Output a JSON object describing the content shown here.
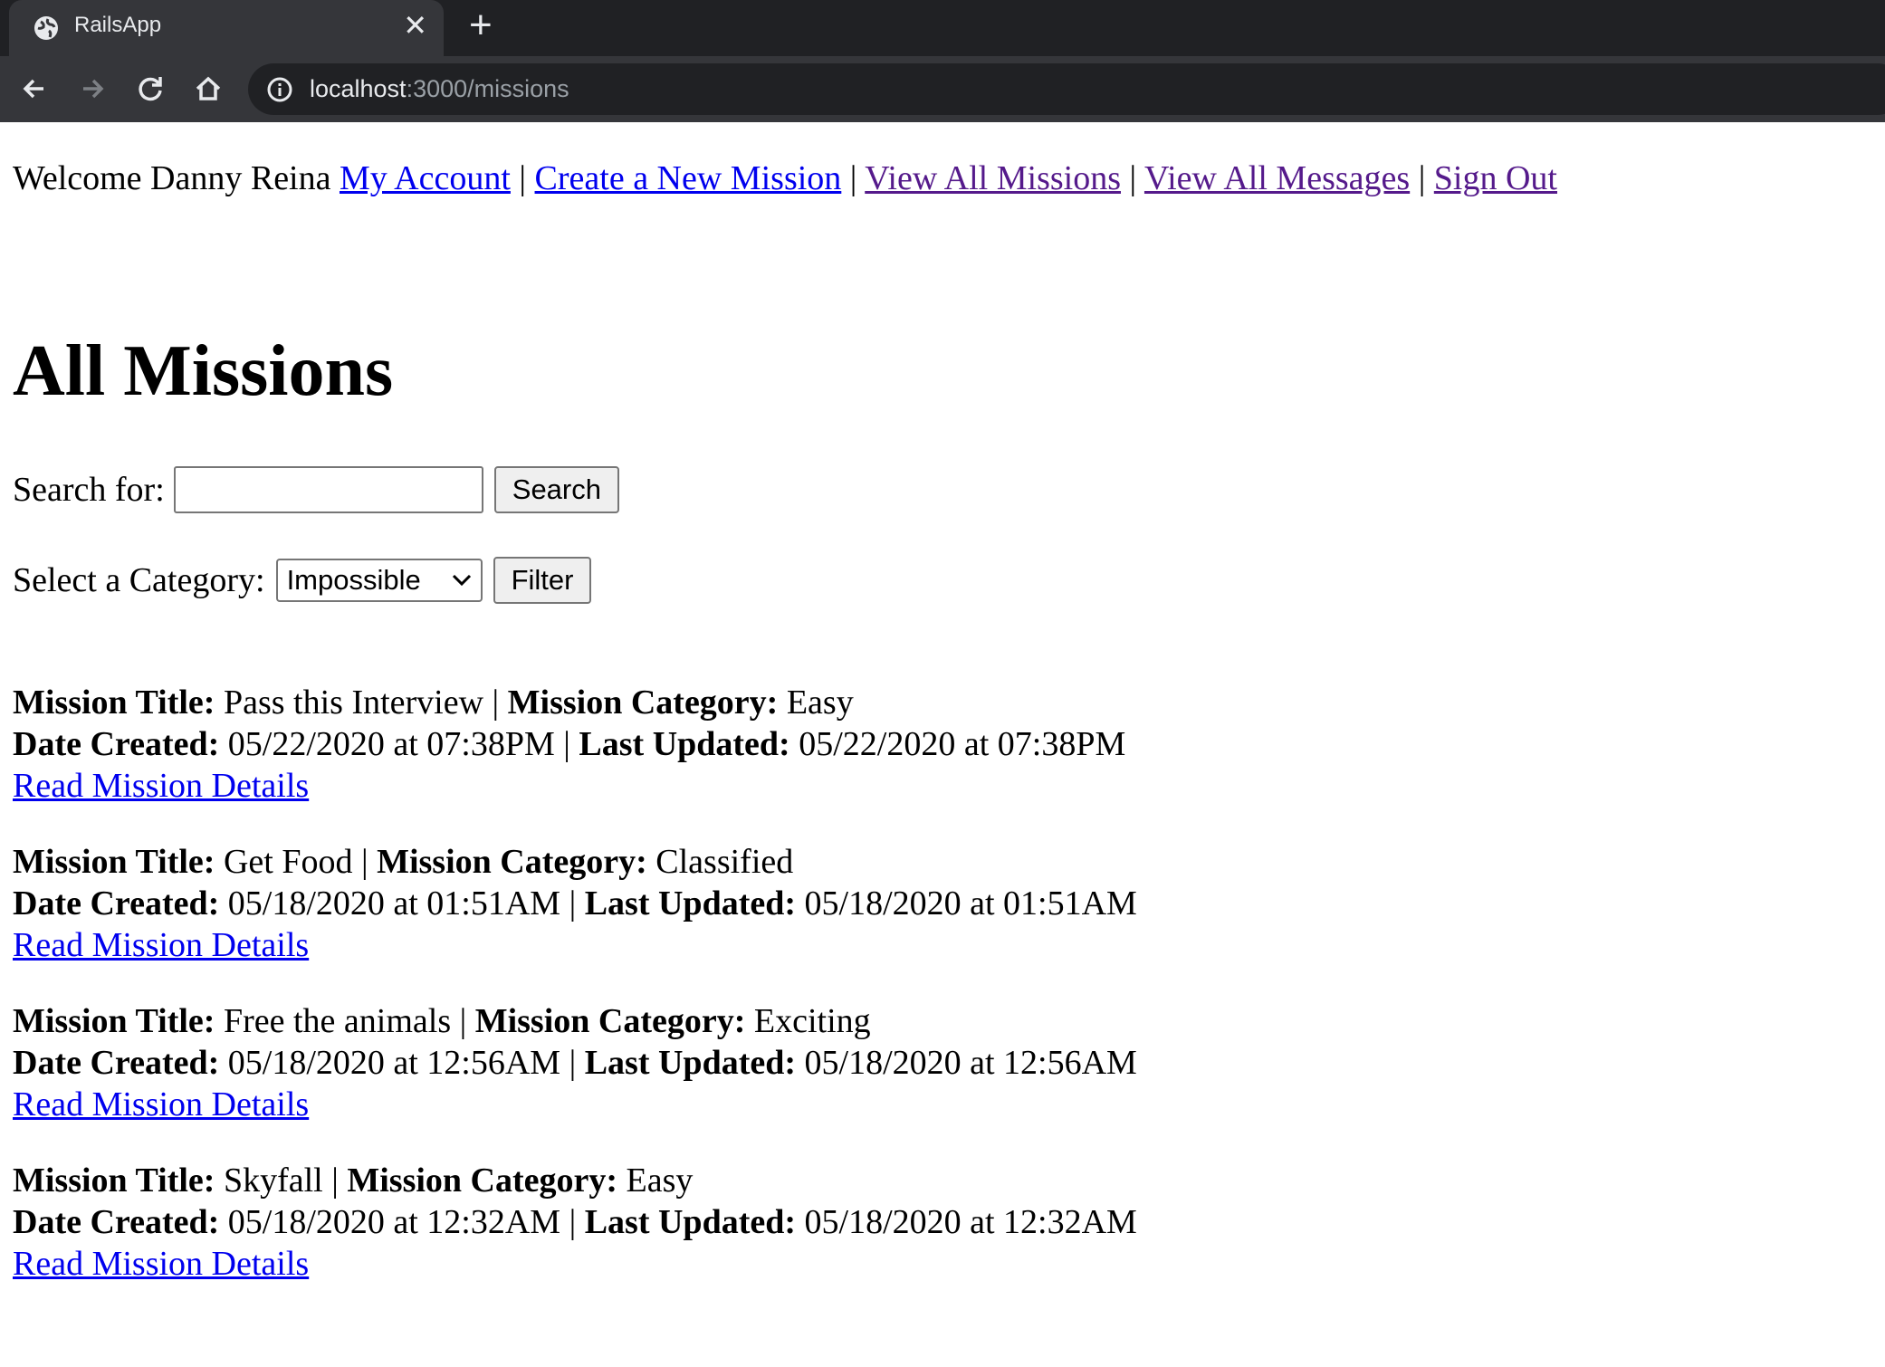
{
  "browser": {
    "tab_title": "RailsApp",
    "close_glyph": "✕",
    "newtab_glyph": "+",
    "url_host": "localhost",
    "url_path": ":3000/missions"
  },
  "nav": {
    "welcome": "Welcome Danny Reina",
    "separator": "|",
    "links": [
      "My Account",
      "Create a New Mission",
      "View All Missions",
      "View All Messages",
      "Sign Out"
    ]
  },
  "heading": "All Missions",
  "search": {
    "label": "Search for:",
    "value": "",
    "button": "Search"
  },
  "filter": {
    "label": "Select a Category:",
    "selected": "Impossible",
    "button": "Filter"
  },
  "labels": {
    "title": "Mission Title:",
    "category": "Mission Category:",
    "created": "Date Created:",
    "updated": "Last Updated:",
    "details": "Read Mission Details"
  },
  "missions": [
    {
      "title": "Pass this Interview",
      "category": "Easy",
      "created": "05/22/2020 at 07:38PM",
      "updated": "05/22/2020 at 07:38PM"
    },
    {
      "title": "Get Food",
      "category": "Classified",
      "created": "05/18/2020 at 01:51AM",
      "updated": "05/18/2020 at 01:51AM"
    },
    {
      "title": "Free the animals",
      "category": "Exciting",
      "created": "05/18/2020 at 12:56AM",
      "updated": "05/18/2020 at 12:56AM"
    },
    {
      "title": "Skyfall",
      "category": "Easy",
      "created": "05/18/2020 at 12:32AM",
      "updated": "05/18/2020 at 12:32AM"
    }
  ]
}
